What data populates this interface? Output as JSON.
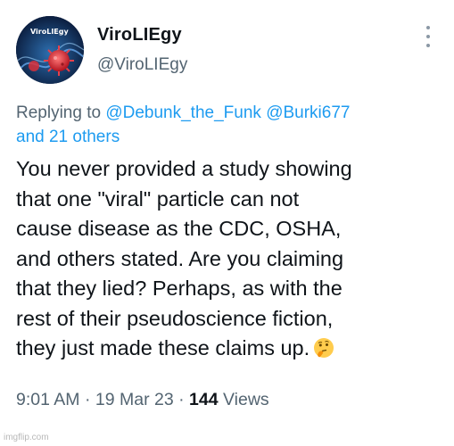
{
  "author": {
    "display_name": "ViroLIEgy",
    "handle": "@ViroLIEgy",
    "avatar_text": "ViroLIEgy"
  },
  "reply": {
    "prefix": "Replying to",
    "mentions": [
      "@Debunk_the_Funk",
      "@Burki677"
    ],
    "others": "and 21 others"
  },
  "body": {
    "lines": [
      "You never provided a study showing",
      "that one \"viral\" particle can not",
      "cause disease as the CDC, OSHA,",
      "and others stated. Are you claiming",
      "that they lied? Perhaps, as with the",
      "rest of their pseudoscience fiction,",
      "they just made these claims up."
    ],
    "emoji": "thinking-face-emoji"
  },
  "meta": {
    "time": "9:01 AM",
    "date": "19 Mar 23",
    "views_count": "144",
    "views_label": "Views",
    "separator": "·"
  },
  "watermark": "imgflip.com",
  "colors": {
    "text": "#0f1419",
    "secondary": "#536471",
    "link": "#1d9bf0"
  }
}
